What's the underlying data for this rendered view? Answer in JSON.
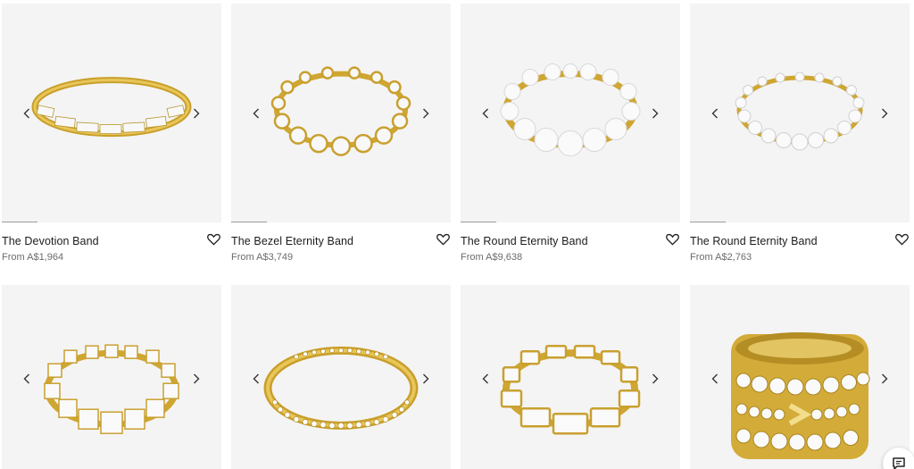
{
  "products": [
    {
      "title": "The Devotion Band",
      "price": "From A$1,964",
      "style": "baguette"
    },
    {
      "title": "The Bezel Eternity Band",
      "price": "From A$3,749",
      "style": "bezel"
    },
    {
      "title": "The Round Eternity Band",
      "price": "From A$9,638",
      "style": "round-large"
    },
    {
      "title": "The Round Eternity Band",
      "price": "From A$2,763",
      "style": "round-small"
    },
    {
      "title": "",
      "price": "",
      "style": "princess"
    },
    {
      "title": "",
      "price": "",
      "style": "channel"
    },
    {
      "title": "",
      "price": "",
      "style": "emerald"
    },
    {
      "title": "",
      "price": "",
      "style": "stack"
    }
  ],
  "icons": {
    "prev": "chevron-left-icon",
    "next": "chevron-right-icon",
    "wishlist": "heart-icon",
    "chat": "chat-icon"
  },
  "colors": {
    "gold": "#d9b43c",
    "gold_dark": "#a8831c",
    "diamond": "#f7f7f7",
    "tile_bg": "#f4f4f4"
  }
}
